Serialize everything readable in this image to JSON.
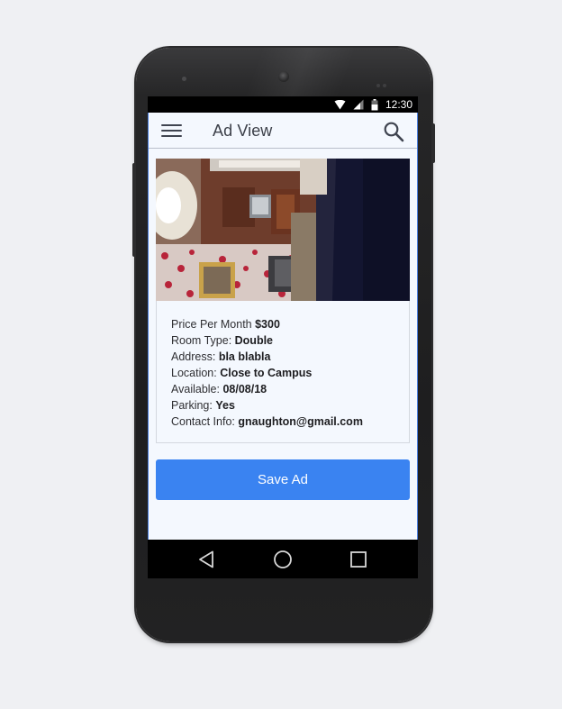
{
  "status_bar": {
    "time": "12:30",
    "icons": [
      "wifi-icon",
      "cell-signal-icon",
      "battery-icon"
    ]
  },
  "toolbar": {
    "title": "Ad View",
    "menu_icon": "menu-icon",
    "search_icon": "search-icon"
  },
  "listing": {
    "photo": "room-photo",
    "fields": [
      {
        "label": "Price Per Month ",
        "value": "$300"
      },
      {
        "label": "Room Type: ",
        "value": "Double"
      },
      {
        "label": "Address: ",
        "value": "bla blabla"
      },
      {
        "label": "Location: ",
        "value": "Close to Campus"
      },
      {
        "label": "Available: ",
        "value": "08/08/18"
      },
      {
        "label": "Parking: ",
        "value": "Yes"
      },
      {
        "label": "Contact Info: ",
        "value": "gnaughton@gmail.com"
      }
    ]
  },
  "actions": {
    "save_label": "Save Ad"
  },
  "nav_bar": {
    "icons": [
      "back-icon",
      "home-icon",
      "recents-icon"
    ]
  },
  "colors": {
    "accent": "#3a83f1",
    "app_background": "#f4f8fe",
    "page_background": "#eff0f3",
    "phone_body": "#1e1e1f"
  }
}
